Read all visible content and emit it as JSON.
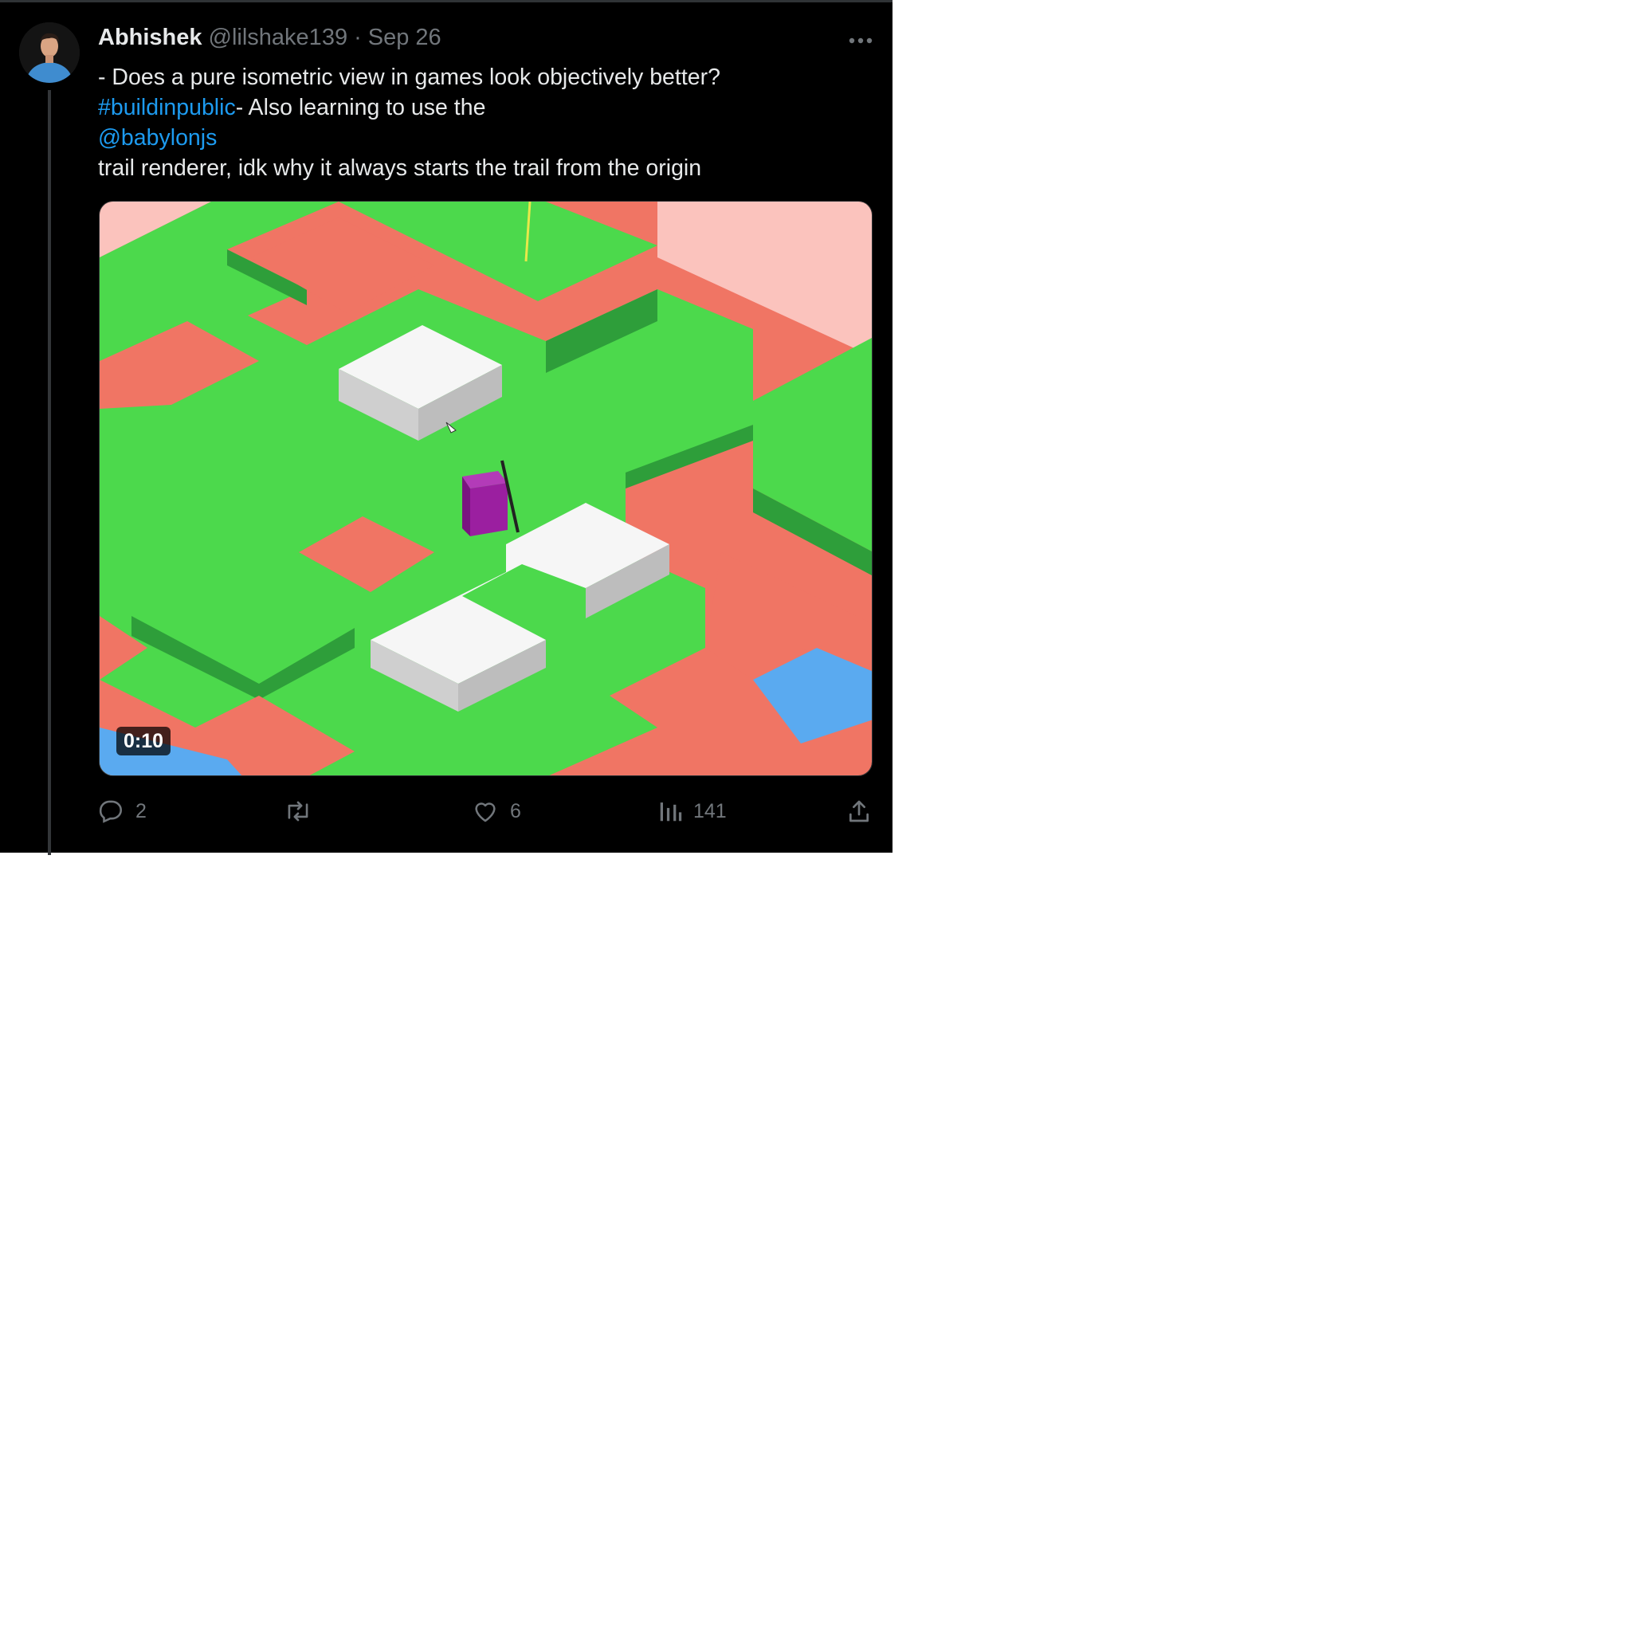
{
  "tweet": {
    "display_name": "Abhishek",
    "handle": "@lilshake139",
    "separator": "·",
    "date": "Sep 26",
    "text": {
      "line1": "- Does a pure isometric view in games look objectively better?",
      "hashtag": "#buildinpublic",
      "line2_rest": "- Also learning to use the",
      "mention": "@babylonjs",
      "line4": "trail renderer, idk why it always starts the trail from the origin"
    },
    "media": {
      "type": "video",
      "duration": "0:10"
    },
    "actions": {
      "replies": "2",
      "retweets": "",
      "likes": "6",
      "views": "141"
    }
  },
  "icons": {
    "more": "more-dots-icon",
    "reply": "reply-bubble-icon",
    "retweet": "retweet-icon",
    "like": "heart-icon",
    "views": "analytics-bars-icon",
    "share": "share-upload-icon"
  },
  "colors": {
    "background": "#000000",
    "text_primary": "#e7e9ea",
    "text_secondary": "#71767b",
    "link": "#1d9bf0",
    "game_green": "#4cd94c",
    "game_coral": "#f07564",
    "game_water": "#5aaaf0",
    "game_cube": "#9b1fa0"
  }
}
